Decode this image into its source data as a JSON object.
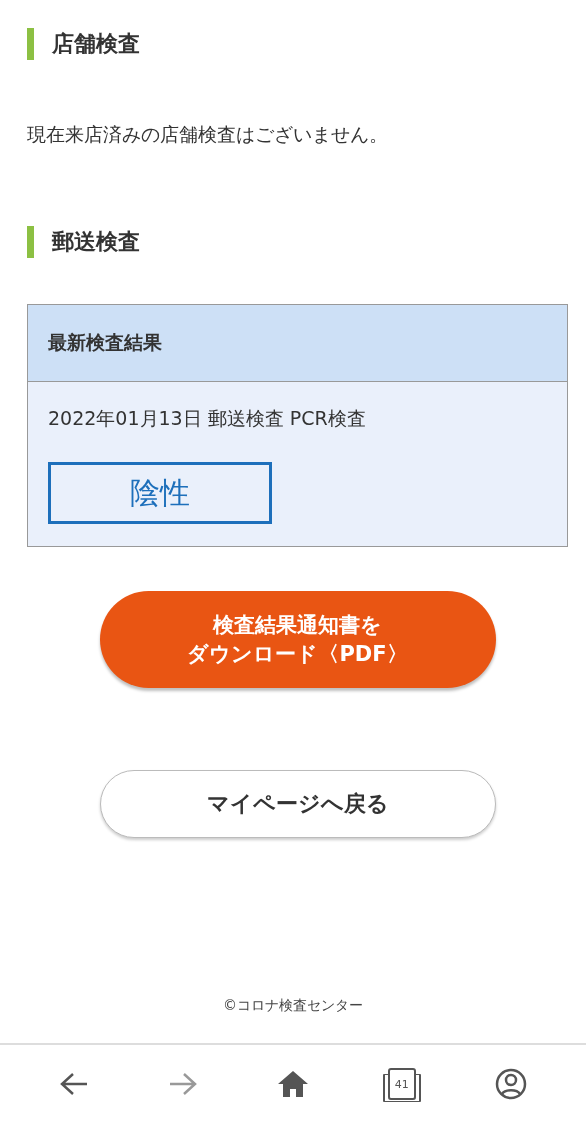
{
  "sections": [
    {
      "heading": "店舗検査",
      "message": "現在来店済みの店舗検査はございません。"
    },
    {
      "heading": "郵送検査",
      "result_card": {
        "title": "最新検査結果",
        "detail": "2022年01月13日 郵送検査 PCR検査",
        "result": "陰性"
      }
    }
  ],
  "download_button": {
    "lines": [
      "検査結果通知書を",
      "ダウンロード〈PDF〉"
    ]
  },
  "back_button": "マイページへ戻る",
  "footer": "©コロナ検査センター",
  "browser_nav": [
    {
      "kind": "back",
      "disabled": false
    },
    {
      "kind": "forward",
      "disabled": true
    },
    {
      "kind": "home",
      "disabled": false
    },
    {
      "kind": "tabs",
      "count": "41",
      "disabled": false
    },
    {
      "kind": "account",
      "disabled": false
    }
  ]
}
